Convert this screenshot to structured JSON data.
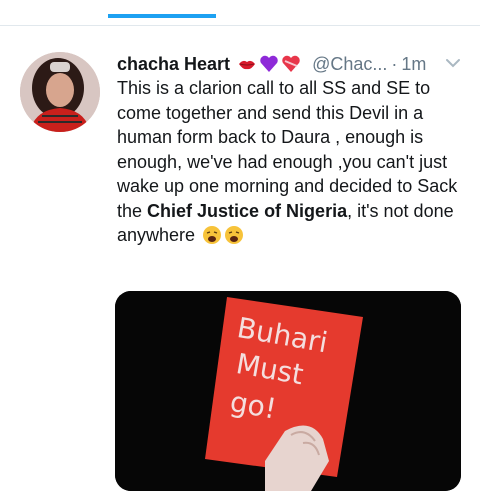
{
  "tweet": {
    "display_name": "chacha Heart",
    "handle": "@Chac...",
    "separator": "·",
    "time": "1m",
    "body_before_bold": "This is a clarion call to all SS and SE to come together and send this Devil in a human form back to Daura , enough is enough, we've had enough ,you can't just wake up one morning  and decided to Sack the ",
    "body_bold": "Chief Justice of Nigeria",
    "body_after_bold": ", it's not done anywhere",
    "name_emojis": [
      "kiss-lips-icon",
      "purple-heart-icon",
      "heart-ribbon-icon"
    ],
    "trailing_emojis": [
      "weary-face-icon",
      "weary-face-icon"
    ],
    "media": {
      "card_text_lines": [
        "Buhari",
        "Must",
        "go!"
      ],
      "card_color": "#e53a2e"
    }
  },
  "colors": {
    "accent": "#1da1f2",
    "text": "#14171a",
    "muted": "#657786",
    "divider": "#e1e8ed"
  }
}
